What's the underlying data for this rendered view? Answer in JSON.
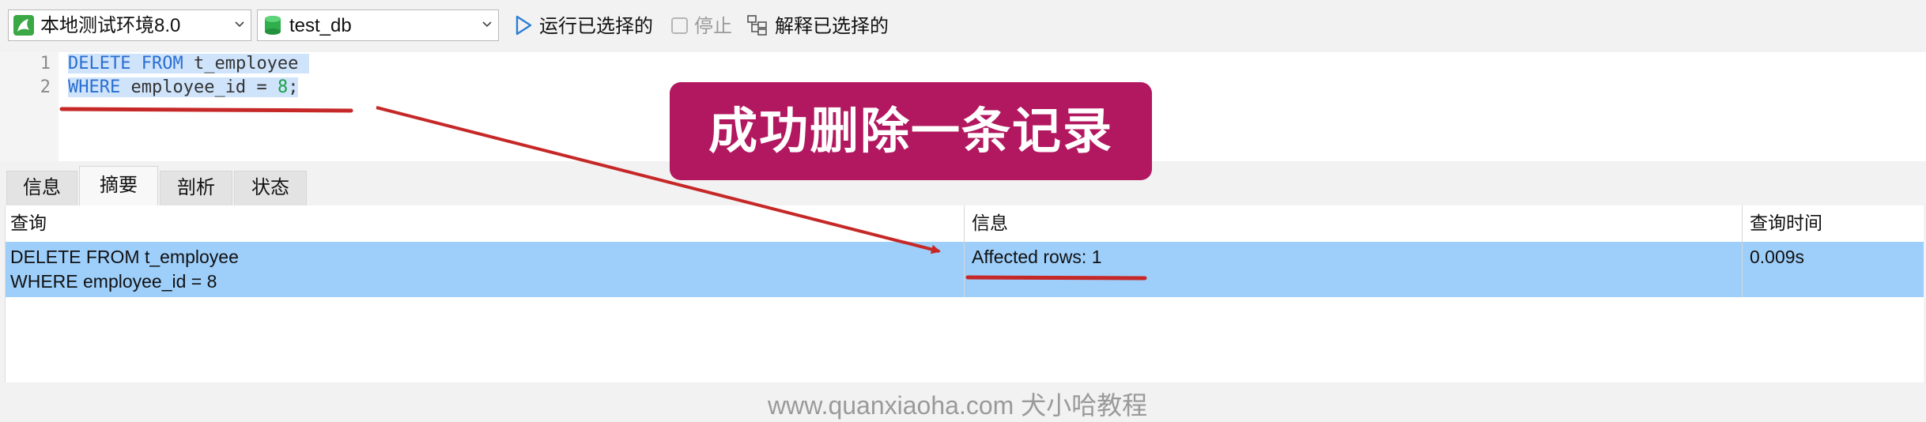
{
  "toolbar": {
    "connection": "本地测试环境8.0",
    "database": "test_db",
    "run_selected": "运行已选择的",
    "stop": "停止",
    "explain_selected": "解释已选择的"
  },
  "editor": {
    "line_numbers": [
      "1",
      "2"
    ],
    "line1": {
      "kw1": "DELETE",
      "kw2": "FROM",
      "rest": "t_employee"
    },
    "line2": {
      "kw": "WHERE",
      "col": "employee_id",
      "op": "=",
      "num": "8",
      "end": ";"
    }
  },
  "annotation": {
    "callout": "成功删除一条记录"
  },
  "result": {
    "tabs": [
      "信息",
      "摘要",
      "剖析",
      "状态"
    ],
    "active_tab": "摘要",
    "columns": [
      "查询",
      "信息",
      "查询时间"
    ],
    "rows": [
      {
        "query_line1": "DELETE FROM t_employee",
        "query_line2": "WHERE employee_id = 8",
        "info": "Affected rows: 1",
        "time": "0.009s"
      }
    ]
  },
  "watermark": "www.quanxiaoha.com 犬小哈教程",
  "colors": {
    "callout": "#b2185f",
    "annotation_red": "#c62828",
    "selection": "#9ecffb",
    "keyword": "#2a6fd1",
    "number": "#1aa04a"
  }
}
